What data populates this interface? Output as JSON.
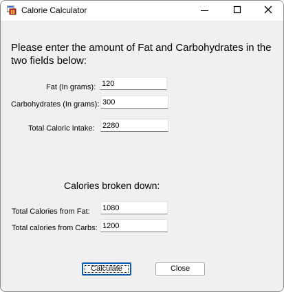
{
  "window": {
    "title": "Calorie Calculator",
    "app_icon": "calculator-app-icon",
    "controls": [
      "minimize-icon",
      "maximize-icon",
      "close-icon"
    ]
  },
  "form": {
    "instruction": "Please enter the amount of Fat and Carbohydrates in the two fields below:",
    "fat_label": "Fat (In grams):",
    "fat_value": "120",
    "carbs_label": "Carbohydrates (In grams):",
    "carbs_value": "300",
    "total_label": "Total Caloric Intake:",
    "total_value": "2280"
  },
  "breakdown": {
    "heading": "Calories broken down:",
    "fat_label": "Total Calories from Fat:",
    "fat_value": "1080",
    "carbs_label": "Total calories from Carbs:",
    "carbs_value": "1200"
  },
  "buttons": {
    "calculate": "Calculate",
    "close": "Close"
  },
  "colors": {
    "window_bg": "#f0f0f0",
    "titlebar_bg": "#ffffff",
    "default_button_border": "#0a5ab4"
  }
}
